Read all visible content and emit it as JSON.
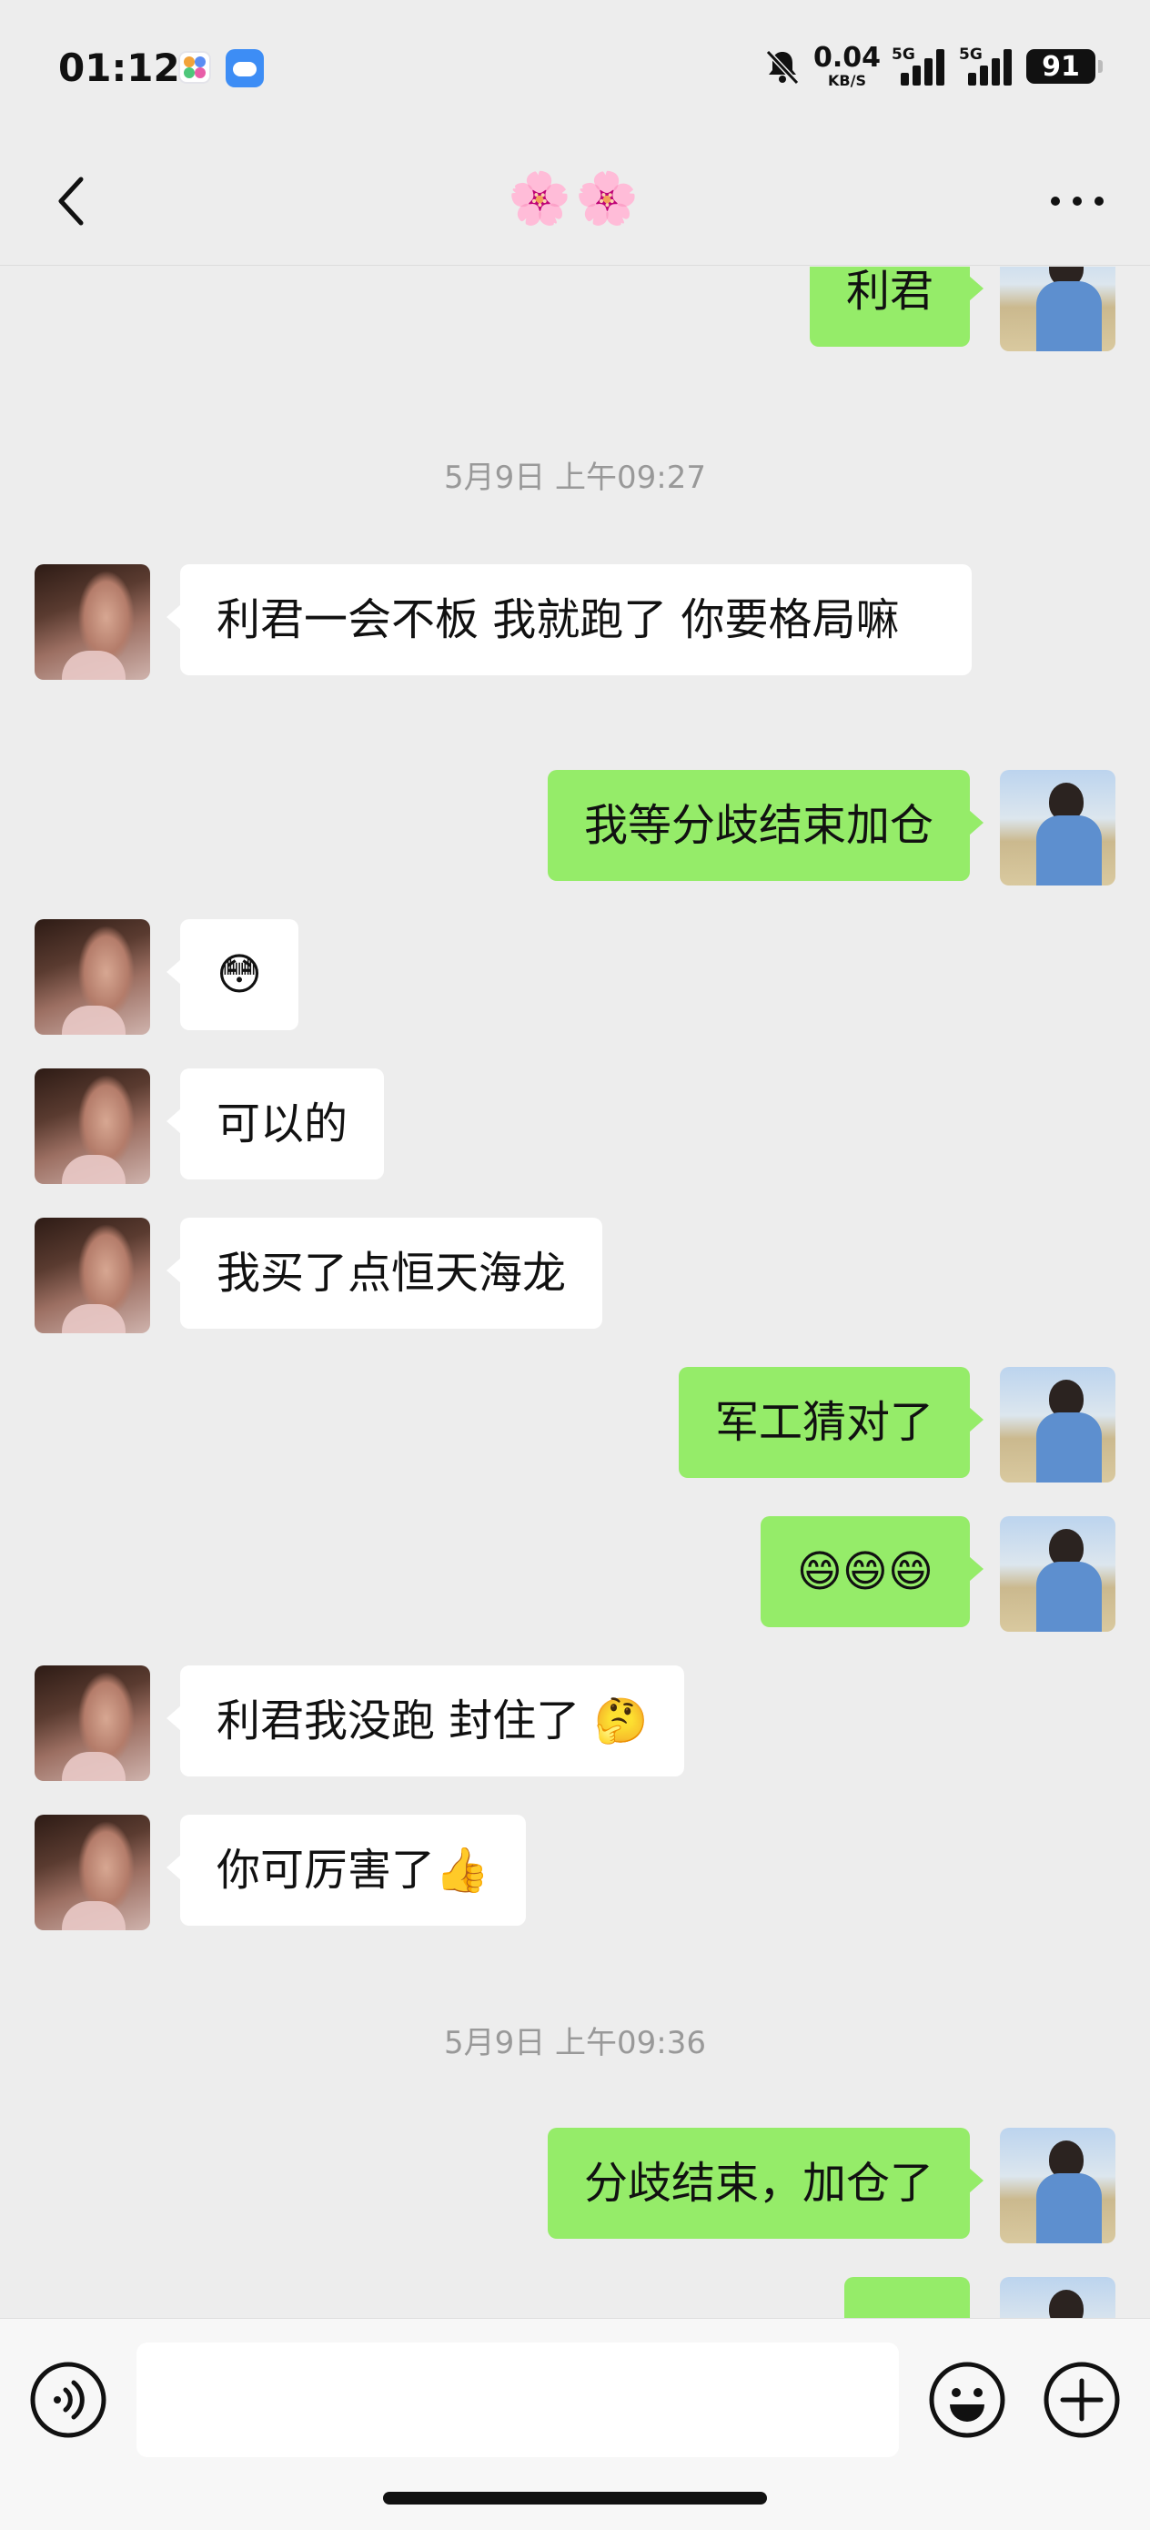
{
  "status_bar": {
    "time": "01:12",
    "net_speed_value": "0.04",
    "net_speed_unit": "KB/S",
    "signal_1_label": "5G",
    "signal_2_label": "5G",
    "battery": "91",
    "icons": [
      "app-icon",
      "weather-icon",
      "mute-bell-icon",
      "signal-icon",
      "signal-icon",
      "battery-icon"
    ]
  },
  "header": {
    "title": "🌸🌸",
    "back_icon": "chevron-left-icon",
    "more_icon": "more-dots-icon"
  },
  "timestamps": [
    "5月9日 上午09:27",
    "5月9日 上午09:36"
  ],
  "messages": [
    {
      "side": "out",
      "text": "利君"
    },
    {
      "side": "in",
      "text": "利君一会不板 我就跑了 你要格局嘛"
    },
    {
      "side": "out",
      "text": "我等分歧结束加仓"
    },
    {
      "side": "in",
      "text": "😳"
    },
    {
      "side": "in",
      "text": "可以的"
    },
    {
      "side": "in",
      "text": "我买了点恒天海龙"
    },
    {
      "side": "out",
      "text": "军工猜对了"
    },
    {
      "side": "out",
      "text": "😄😄😄"
    },
    {
      "side": "in",
      "text": "利君我没跑 封住了 🤔"
    },
    {
      "side": "in",
      "text": "你可厉害了👍"
    },
    {
      "side": "out",
      "text": "分歧结束，加仓了"
    },
    {
      "side": "out",
      "text": ""
    }
  ],
  "input_bar": {
    "voice_icon": "voice-icon",
    "emoji_icon": "emoji-icon",
    "plus_icon": "plus-icon",
    "text": ""
  },
  "colors": {
    "background": "#ededed",
    "outgoing_bubble": "#95ec69",
    "incoming_bubble": "#ffffff",
    "timestamp_text": "#999999"
  }
}
